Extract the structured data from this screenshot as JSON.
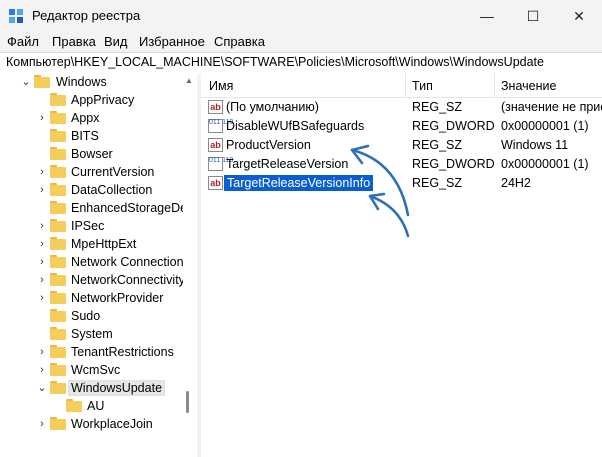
{
  "window": {
    "title": "Редактор реестра",
    "controls": {
      "minimize": "—",
      "maximize": "☐",
      "close": "✕"
    }
  },
  "menu": [
    {
      "label": "Файл"
    },
    {
      "label": "Правка"
    },
    {
      "label": "Вид"
    },
    {
      "label": "Избранное"
    },
    {
      "label": "Справка"
    }
  ],
  "address": "Компьютер\\HKEY_LOCAL_MACHINE\\SOFTWARE\\Policies\\Microsoft\\Windows\\WindowsUpdate",
  "tree": {
    "parent": "Windows",
    "items": [
      {
        "label": "AppPrivacy",
        "expandable": false
      },
      {
        "label": "Appx",
        "expandable": true
      },
      {
        "label": "BITS",
        "expandable": false
      },
      {
        "label": "Bowser",
        "expandable": false
      },
      {
        "label": "CurrentVersion",
        "expandable": true
      },
      {
        "label": "DataCollection",
        "expandable": true
      },
      {
        "label": "EnhancedStorageDev",
        "expandable": false
      },
      {
        "label": "IPSec",
        "expandable": true
      },
      {
        "label": "MpeHttpExt",
        "expandable": true
      },
      {
        "label": "Network Connection",
        "expandable": true
      },
      {
        "label": "NetworkConnectivity",
        "expandable": true
      },
      {
        "label": "NetworkProvider",
        "expandable": true
      },
      {
        "label": "Sudo",
        "expandable": false
      },
      {
        "label": "System",
        "expandable": false
      },
      {
        "label": "TenantRestrictions",
        "expandable": true
      },
      {
        "label": "WcmSvc",
        "expandable": true
      },
      {
        "label": "WindowsUpdate",
        "expandable": true,
        "expanded": true,
        "selected": true
      },
      {
        "label": "AU",
        "expandable": false,
        "child": true
      },
      {
        "label": "WorkplaceJoin",
        "expandable": true
      }
    ]
  },
  "values_table": {
    "headers": {
      "name": "Имя",
      "type": "Тип",
      "data": "Значение"
    },
    "rows": [
      {
        "name": "(По умолчанию)",
        "type": "REG_SZ",
        "data": "(значение не присвоено)",
        "icon": "string-value-icon",
        "kind": "sz"
      },
      {
        "name": "DisableWUfBSafeguards",
        "type": "REG_DWORD",
        "data": "0x00000001 (1)",
        "icon": "dword-value-icon",
        "kind": "dw"
      },
      {
        "name": "ProductVersion",
        "type": "REG_SZ",
        "data": "Windows 11",
        "icon": "string-value-icon",
        "kind": "sz"
      },
      {
        "name": "TargetReleaseVersion",
        "type": "REG_DWORD",
        "data": "0x00000001 (1)",
        "icon": "dword-value-icon",
        "kind": "dw"
      },
      {
        "name": "TargetReleaseVersionInfo",
        "type": "REG_SZ",
        "data": "24H2",
        "icon": "string-value-icon",
        "kind": "sz",
        "selected": true
      }
    ]
  },
  "icon_glyphs": {
    "sz": "ab",
    "dw": "011 110"
  },
  "colors": {
    "accent": "#0a5fd0",
    "annotation_arrow": "#2f6fb8",
    "folder": "#f5cd5b"
  }
}
